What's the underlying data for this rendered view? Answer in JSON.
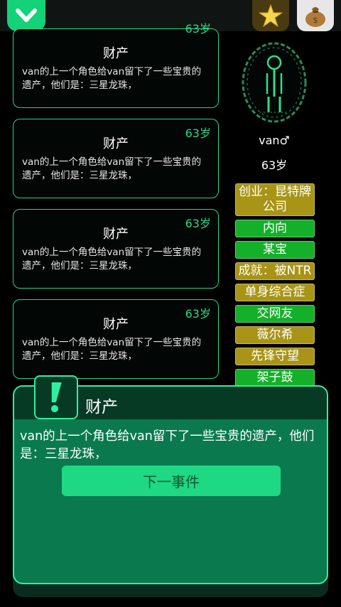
{
  "topbar": {
    "menu_icon": "chevron-down-icon",
    "star_icon": "star-icon",
    "bag_icon": "money-bag-icon"
  },
  "events": [
    {
      "age": "63岁",
      "title": "财产",
      "desc": "van的上一个角色给van留下了一些宝贵的遗产，他们是：三星龙珠，"
    },
    {
      "age": "63岁",
      "title": "财产",
      "desc": "van的上一个角色给van留下了一些宝贵的遗产，他们是：三星龙珠，"
    },
    {
      "age": "63岁",
      "title": "财产",
      "desc": "van的上一个角色给van留下了一些宝贵的遗产，他们是：三星龙珠，"
    },
    {
      "age": "63岁",
      "title": "财产",
      "desc": "van的上一个角色给van留下了一些宝贵的遗产，他们是：三星龙珠，"
    }
  ],
  "character": {
    "name": "van♂",
    "age": "63岁"
  },
  "traits": [
    {
      "label": "创业：昆特牌公司",
      "color": "gold"
    },
    {
      "label": "内向",
      "color": "green"
    },
    {
      "label": "某宝",
      "color": "green"
    },
    {
      "label": "成就：被NTR",
      "color": "gold"
    },
    {
      "label": "单身综合症",
      "color": "gold"
    },
    {
      "label": "交网友",
      "color": "green"
    },
    {
      "label": "薇尔希",
      "color": "gold"
    },
    {
      "label": "先锋守望",
      "color": "gold"
    },
    {
      "label": "架子鼓",
      "color": "green"
    }
  ],
  "dialog": {
    "title": "财产",
    "text": "van的上一个角色给van留下了一些宝贵的遗产，他们是：三星龙珠，",
    "next_button": "下一事件",
    "icon": "exclamation-icon"
  },
  "colors": {
    "accent": "#1ed88c",
    "gold_trait": "#a89416",
    "green_trait": "#14b02a",
    "dialog_bg": "#0a7a4e"
  }
}
